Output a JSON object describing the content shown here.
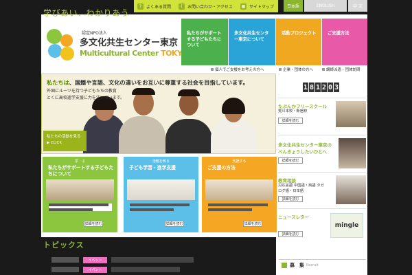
{
  "topbar": {
    "faq": "よくある質問",
    "contact": "お問い合わせ・アクセス",
    "sitemap": "サイトマップ",
    "langs": [
      "日本語",
      "ENGLISH",
      "中 文"
    ]
  },
  "header": {
    "tagline": "学びあい、わかりあう",
    "npo": "認定NPO法人",
    "org_name": "多文化共生センター東京",
    "org_en_a": "Multicultural Center ",
    "org_en_b": "TOKYO"
  },
  "nav": [
    {
      "label": "私たちがサポートする子どもたちについて",
      "color": "#4cb04c"
    },
    {
      "label": "多文化共生センター東京について",
      "color": "#2aa4d6"
    },
    {
      "label": "活動プロジェクト",
      "color": "#f0a821"
    },
    {
      "label": "ご支援方法",
      "color": "#e85aa7"
    }
  ],
  "subnav": [
    "個人でご支援をお考えの方へ",
    "企業・団体の方へ",
    "講師派遣・団体訪問"
  ],
  "hero": {
    "head_a": "私たちは",
    "head_b": "、国籍や言語、文化の違いをお互いに尊重する社会を目指しています。",
    "sub1": "外国にルーツを持つ子どもたちの教育",
    "sub2": "とくに高校進学支援に力を注いでいます。",
    "badge1": "私たちの活動を見る",
    "badge2": "▶ CLICK"
  },
  "cards": [
    {
      "tag": "学　ぶ",
      "title": "私たちがサポートする子どもたちについて",
      "text": "",
      "btn": "詳細を読む",
      "color": "#8cc63f"
    },
    {
      "tag": "活動を知る",
      "title": "子ども学習・進学支援",
      "text": "",
      "btn": "詳細を読む",
      "color": "#5bbfe8"
    },
    {
      "tag": "支援する",
      "title": "ご支援の方法",
      "text": "",
      "btn": "詳細を読む",
      "color": "#f5a623"
    }
  ],
  "counter": {
    "label": "",
    "digits": [
      "1",
      "8",
      "1",
      "2",
      "0",
      "3"
    ]
  },
  "sidebar": [
    {
      "title": "たぶんかフリースクール",
      "text": "荒川本校・新宿校",
      "btn": "詳細を読む"
    },
    {
      "title": "多文化共生センター東京の べんきょうしたいひとへ",
      "text": "",
      "btn": "詳細を読む"
    },
    {
      "title": "教育相談",
      "text": "対応言語 中国語・英語 タガログ語・日本語",
      "btn": "詳細を読む"
    },
    {
      "title": "ニュースレター",
      "text": "mingle",
      "btn": "詳細を読む"
    }
  ],
  "news": {
    "title": "トピックス",
    "rows": [
      {
        "cat": "イベント"
      },
      {
        "cat": "イベント"
      }
    ]
  },
  "bosyu": {
    "title": "募　集",
    "en": "Recruit"
  }
}
